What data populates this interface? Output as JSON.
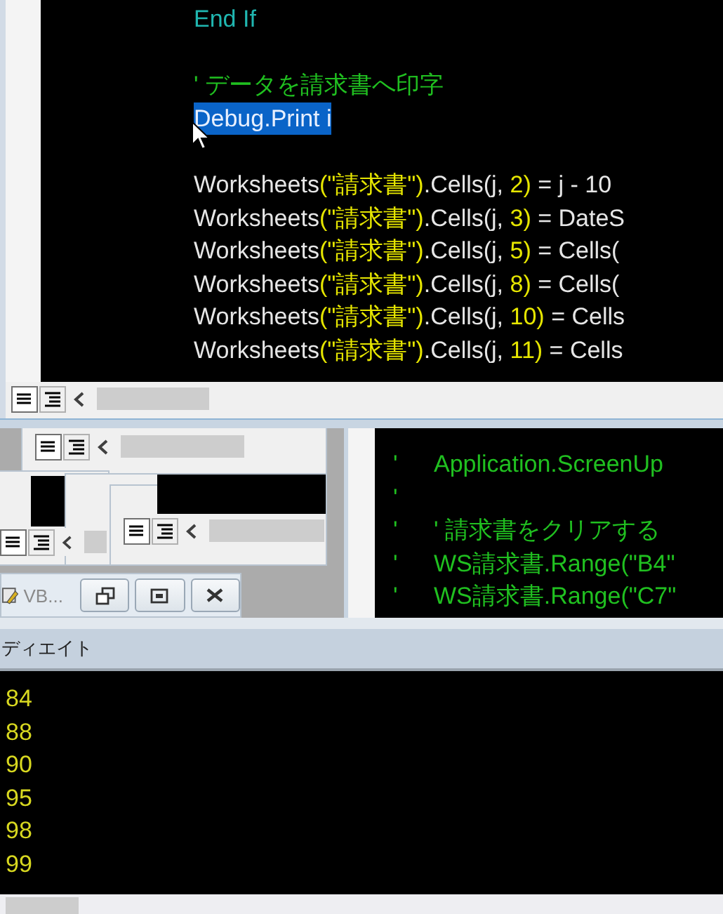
{
  "code_window": {
    "lines": [
      {
        "kind": "keyword",
        "parts": [
          "End If"
        ]
      },
      {
        "kind": "blank"
      },
      {
        "kind": "comment",
        "parts": [
          "' データを請求書へ印字"
        ]
      },
      {
        "kind": "selected",
        "parts": [
          "Debug.Print i"
        ]
      },
      {
        "kind": "blank"
      },
      {
        "kind": "code",
        "parts": [
          "Worksheets",
          "(\"請求書\")",
          ".Cells(j, ",
          "2)",
          " = j - 10"
        ]
      },
      {
        "kind": "code",
        "parts": [
          "Worksheets",
          "(\"請求書\")",
          ".Cells(j, ",
          "3)",
          " = DateS"
        ]
      },
      {
        "kind": "code",
        "parts": [
          "Worksheets",
          "(\"請求書\")",
          ".Cells(j, ",
          "5)",
          " = Cells("
        ]
      },
      {
        "kind": "code",
        "parts": [
          "Worksheets",
          "(\"請求書\")",
          ".Cells(j, ",
          "8)",
          " = Cells("
        ]
      },
      {
        "kind": "code",
        "parts": [
          "Worksheets",
          "(\"請求書\")",
          ".Cells(j, ",
          "10)",
          " = Cells"
        ]
      },
      {
        "kind": "code",
        "parts": [
          "Worksheets",
          "(\"請求書\")",
          ".Cells(j, ",
          "11)",
          " = Cells"
        ]
      }
    ]
  },
  "module_window": {
    "lines": [
      {
        "marker": "'",
        "text": "Application.ScreenUp"
      },
      {
        "marker": "'"
      },
      {
        "marker": "'",
        "text": "' 請求書をクリアする"
      },
      {
        "marker": "'",
        "text": "WS請求書.Range(\"B4\""
      },
      {
        "marker": "'",
        "text": "WS請求書.Range(\"C7\""
      }
    ]
  },
  "minimized_window": {
    "title": "VB..."
  },
  "immediate_window": {
    "title": "ディエイト",
    "output": [
      "84",
      "88",
      "90",
      "95",
      "98",
      "99"
    ]
  }
}
